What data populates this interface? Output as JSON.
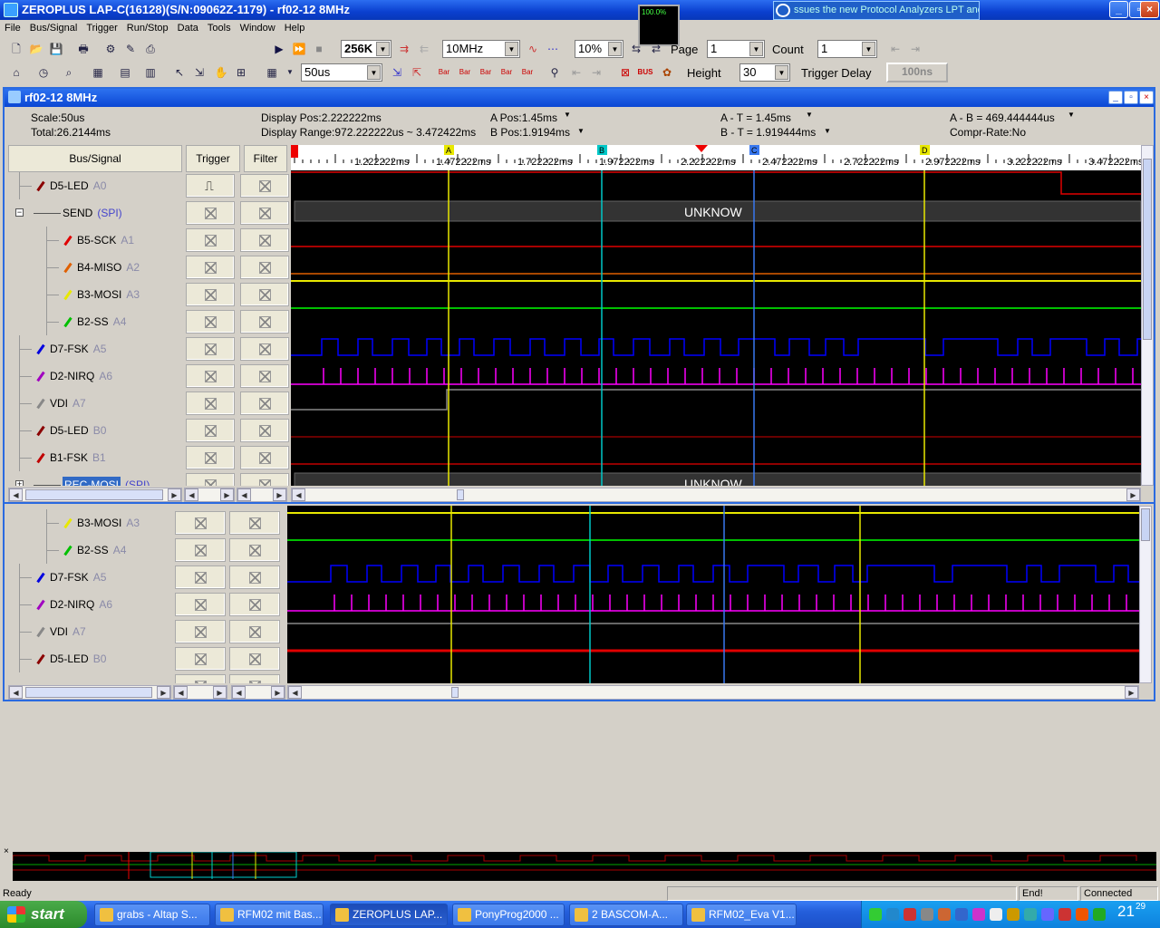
{
  "app": {
    "title": "ZEROPLUS LAP-C(16128)(S/N:09062Z-1179) - rf02-12 8MHz",
    "ticker": "ssues the new Protocol Analyzers LPT and",
    "percent": "100.0%"
  },
  "menu": [
    "File",
    "Bus/Signal",
    "Trigger",
    "Run/Stop",
    "Data",
    "Tools",
    "Window",
    "Help"
  ],
  "toolbar": {
    "memory": "256K",
    "clock": "10MHz",
    "trigger_pos": "10%",
    "page_label": "Page",
    "page_value": "1",
    "count_label": "Count",
    "count_value": "1",
    "scale": "50us",
    "height_label": "Height",
    "height_value": "30",
    "trigger_delay_label": "Trigger Delay",
    "trigger_delay_value": "100ns",
    "bar_labels": [
      "Bar",
      "Bar",
      "Bar",
      "Bar",
      "Bar"
    ],
    "bus_label": "BUS"
  },
  "doc": {
    "title": "rf02-12 8MHz",
    "scale": "Scale:50us",
    "total": "Total:26.2144ms",
    "display_pos": "Display Pos:2.222222ms",
    "display_range": "Display Range:972.222222us ~ 3.472422ms",
    "a_pos": "A Pos:1.45ms",
    "b_pos": "B Pos:1.9194ms",
    "a_t": "A - T = 1.45ms",
    "b_t": "B - T = 1.919444ms",
    "a_b": "A - B = 469.444444us",
    "compr": "Compr-Rate:No"
  },
  "headers": {
    "bus": "Bus/Signal",
    "trigger": "Trigger",
    "filter": "Filter"
  },
  "ticks": [
    "1.222222ms",
    "1.472222ms",
    "1.722222ms",
    "1.972222ms",
    "2.222222ms",
    "2.472222ms",
    "2.722222ms",
    "2.972222ms",
    "3.222222ms",
    "3.472222ms"
  ],
  "cursors": {
    "t": "T",
    "a": "A",
    "b": "B",
    "c": "C",
    "d": "D"
  },
  "signals": [
    {
      "name": "D5-LED",
      "ch": "A0",
      "color": "#8b0000",
      "indent": 0
    },
    {
      "name": "SEND",
      "ch": "(SPI)",
      "color": "",
      "indent": 0,
      "bus": true
    },
    {
      "name": "B5-SCK",
      "ch": "A1",
      "color": "#e00000",
      "indent": 1
    },
    {
      "name": "B4-MISO",
      "ch": "A2",
      "color": "#e06000",
      "indent": 1
    },
    {
      "name": "B3-MOSI",
      "ch": "A3",
      "color": "#e8e800",
      "indent": 1
    },
    {
      "name": "B2-SS",
      "ch": "A4",
      "color": "#00c000",
      "indent": 1
    },
    {
      "name": "D7-FSK",
      "ch": "A5",
      "color": "#0000e0",
      "indent": 0
    },
    {
      "name": "D2-NIRQ",
      "ch": "A6",
      "color": "#a000c0",
      "indent": 0
    },
    {
      "name": "VDI",
      "ch": "A7",
      "color": "#888888",
      "indent": 0
    },
    {
      "name": "D5-LED",
      "ch": "B0",
      "color": "#8b0000",
      "indent": 0
    },
    {
      "name": "B1-FSK",
      "ch": "B1",
      "color": "#c00000",
      "indent": 0
    },
    {
      "name": "REC-MOSI",
      "ch": "(SPI)",
      "color": "",
      "indent": 0,
      "bus": true
    }
  ],
  "signals2": [
    {
      "name": "B3-MOSI",
      "ch": "A3",
      "color": "#e8e800",
      "indent": 1
    },
    {
      "name": "B2-SS",
      "ch": "A4",
      "color": "#00c000",
      "indent": 1
    },
    {
      "name": "D7-FSK",
      "ch": "A5",
      "color": "#0000e0",
      "indent": 0
    },
    {
      "name": "D2-NIRQ",
      "ch": "A6",
      "color": "#a000c0",
      "indent": 0
    },
    {
      "name": "VDI",
      "ch": "A7",
      "color": "#888888",
      "indent": 0
    },
    {
      "name": "D5-LED",
      "ch": "B0",
      "color": "#8b0000",
      "indent": 0
    }
  ],
  "bus_value": "UNKNOW",
  "status": {
    "ready": "Ready",
    "end": "End!",
    "connected": "Connected"
  },
  "taskbar": {
    "start": "start",
    "tasks": [
      "grabs - Altap S...",
      "RFM02 mit Bas...",
      "ZEROPLUS LAP...",
      "PonyProg2000 ...",
      "2 BASCOM-A...",
      "RFM02_Eva V1..."
    ],
    "clock_h": "21",
    "clock_m": "29"
  }
}
